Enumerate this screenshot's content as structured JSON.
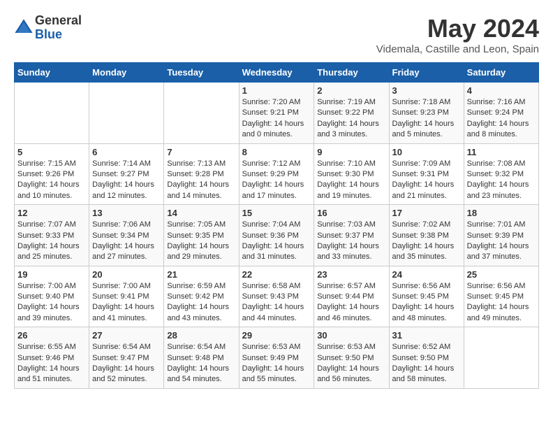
{
  "header": {
    "logo_general": "General",
    "logo_blue": "Blue",
    "month_title": "May 2024",
    "location": "Videmala, Castille and Leon, Spain"
  },
  "calendar": {
    "days_of_week": [
      "Sunday",
      "Monday",
      "Tuesday",
      "Wednesday",
      "Thursday",
      "Friday",
      "Saturday"
    ],
    "weeks": [
      [
        {
          "day": "",
          "info": ""
        },
        {
          "day": "",
          "info": ""
        },
        {
          "day": "",
          "info": ""
        },
        {
          "day": "1",
          "info": "Sunrise: 7:20 AM\nSunset: 9:21 PM\nDaylight: 14 hours\nand 0 minutes."
        },
        {
          "day": "2",
          "info": "Sunrise: 7:19 AM\nSunset: 9:22 PM\nDaylight: 14 hours\nand 3 minutes."
        },
        {
          "day": "3",
          "info": "Sunrise: 7:18 AM\nSunset: 9:23 PM\nDaylight: 14 hours\nand 5 minutes."
        },
        {
          "day": "4",
          "info": "Sunrise: 7:16 AM\nSunset: 9:24 PM\nDaylight: 14 hours\nand 8 minutes."
        }
      ],
      [
        {
          "day": "5",
          "info": "Sunrise: 7:15 AM\nSunset: 9:26 PM\nDaylight: 14 hours\nand 10 minutes."
        },
        {
          "day": "6",
          "info": "Sunrise: 7:14 AM\nSunset: 9:27 PM\nDaylight: 14 hours\nand 12 minutes."
        },
        {
          "day": "7",
          "info": "Sunrise: 7:13 AM\nSunset: 9:28 PM\nDaylight: 14 hours\nand 14 minutes."
        },
        {
          "day": "8",
          "info": "Sunrise: 7:12 AM\nSunset: 9:29 PM\nDaylight: 14 hours\nand 17 minutes."
        },
        {
          "day": "9",
          "info": "Sunrise: 7:10 AM\nSunset: 9:30 PM\nDaylight: 14 hours\nand 19 minutes."
        },
        {
          "day": "10",
          "info": "Sunrise: 7:09 AM\nSunset: 9:31 PM\nDaylight: 14 hours\nand 21 minutes."
        },
        {
          "day": "11",
          "info": "Sunrise: 7:08 AM\nSunset: 9:32 PM\nDaylight: 14 hours\nand 23 minutes."
        }
      ],
      [
        {
          "day": "12",
          "info": "Sunrise: 7:07 AM\nSunset: 9:33 PM\nDaylight: 14 hours\nand 25 minutes."
        },
        {
          "day": "13",
          "info": "Sunrise: 7:06 AM\nSunset: 9:34 PM\nDaylight: 14 hours\nand 27 minutes."
        },
        {
          "day": "14",
          "info": "Sunrise: 7:05 AM\nSunset: 9:35 PM\nDaylight: 14 hours\nand 29 minutes."
        },
        {
          "day": "15",
          "info": "Sunrise: 7:04 AM\nSunset: 9:36 PM\nDaylight: 14 hours\nand 31 minutes."
        },
        {
          "day": "16",
          "info": "Sunrise: 7:03 AM\nSunset: 9:37 PM\nDaylight: 14 hours\nand 33 minutes."
        },
        {
          "day": "17",
          "info": "Sunrise: 7:02 AM\nSunset: 9:38 PM\nDaylight: 14 hours\nand 35 minutes."
        },
        {
          "day": "18",
          "info": "Sunrise: 7:01 AM\nSunset: 9:39 PM\nDaylight: 14 hours\nand 37 minutes."
        }
      ],
      [
        {
          "day": "19",
          "info": "Sunrise: 7:00 AM\nSunset: 9:40 PM\nDaylight: 14 hours\nand 39 minutes."
        },
        {
          "day": "20",
          "info": "Sunrise: 7:00 AM\nSunset: 9:41 PM\nDaylight: 14 hours\nand 41 minutes."
        },
        {
          "day": "21",
          "info": "Sunrise: 6:59 AM\nSunset: 9:42 PM\nDaylight: 14 hours\nand 43 minutes."
        },
        {
          "day": "22",
          "info": "Sunrise: 6:58 AM\nSunset: 9:43 PM\nDaylight: 14 hours\nand 44 minutes."
        },
        {
          "day": "23",
          "info": "Sunrise: 6:57 AM\nSunset: 9:44 PM\nDaylight: 14 hours\nand 46 minutes."
        },
        {
          "day": "24",
          "info": "Sunrise: 6:56 AM\nSunset: 9:45 PM\nDaylight: 14 hours\nand 48 minutes."
        },
        {
          "day": "25",
          "info": "Sunrise: 6:56 AM\nSunset: 9:45 PM\nDaylight: 14 hours\nand 49 minutes."
        }
      ],
      [
        {
          "day": "26",
          "info": "Sunrise: 6:55 AM\nSunset: 9:46 PM\nDaylight: 14 hours\nand 51 minutes."
        },
        {
          "day": "27",
          "info": "Sunrise: 6:54 AM\nSunset: 9:47 PM\nDaylight: 14 hours\nand 52 minutes."
        },
        {
          "day": "28",
          "info": "Sunrise: 6:54 AM\nSunset: 9:48 PM\nDaylight: 14 hours\nand 54 minutes."
        },
        {
          "day": "29",
          "info": "Sunrise: 6:53 AM\nSunset: 9:49 PM\nDaylight: 14 hours\nand 55 minutes."
        },
        {
          "day": "30",
          "info": "Sunrise: 6:53 AM\nSunset: 9:50 PM\nDaylight: 14 hours\nand 56 minutes."
        },
        {
          "day": "31",
          "info": "Sunrise: 6:52 AM\nSunset: 9:50 PM\nDaylight: 14 hours\nand 58 minutes."
        },
        {
          "day": "",
          "info": ""
        }
      ]
    ]
  }
}
